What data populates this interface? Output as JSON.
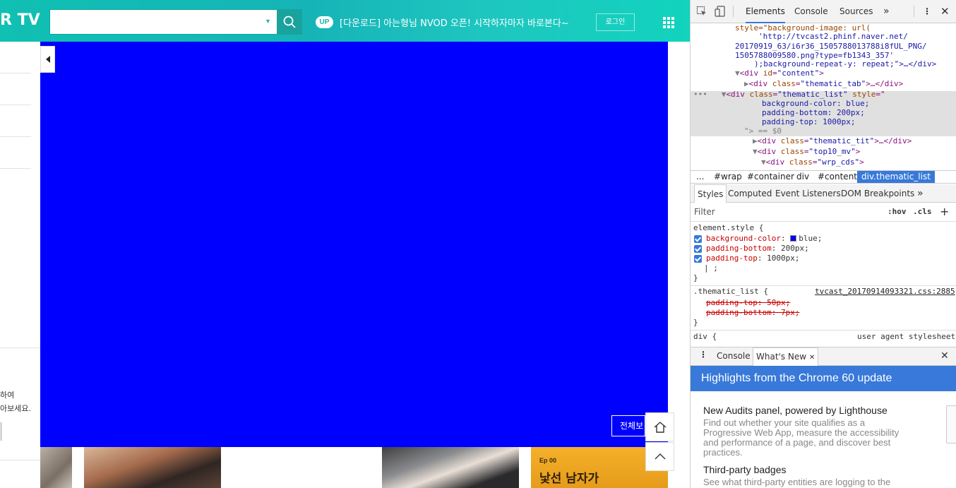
{
  "page": {
    "logo": "R TV",
    "search": {
      "value": "",
      "placeholder": ""
    },
    "up_badge": "UP",
    "notice": "[다운로드] 아는형님 NVOD 오픈! 시작하자마자 바로본다~",
    "login": "로그인",
    "left_panel": {
      "line1": "하여",
      "line2": "아보세요."
    },
    "all_button": "전체보",
    "thumb4_ep": "Ep 00",
    "thumb4_title": "낯선 남자가",
    "colors": {
      "header": "#16b4b7",
      "content_bg": "blue",
      "accent": "#1aa29c"
    }
  },
  "devtools": {
    "tabs": [
      "Elements",
      "Console",
      "Sources"
    ],
    "dom": {
      "l1": "style=\"background-image: url(",
      "l2": "'http://tvcast2.phinf.naver.net/",
      "l3": "20170919_63/i6r36_1505788013788i8fUL_PNG/",
      "l4": "1505788009580.png?type=fb1343_357'",
      "l5": ");background-repeat-y: repeat;\">…</div>",
      "l6_tag": "div",
      "l6_attr": "id",
      "l6_val": "\"content\"",
      "l7_class": "\"thematic_tab\"",
      "l8_class": "\"thematic_list\"",
      "l9": "background-color: blue;",
      "l10": "padding-bottom: 200px;",
      "l11": "padding-top: 1000px;",
      "l12": "\"> == $0",
      "l13_class": "\"thematic_tit\"",
      "l14_class": "\"top10_mv\"",
      "l15_class": "\"wrp_cds\""
    },
    "breadcrumbs": [
      "...",
      "#wrap",
      "#container",
      "div",
      "#content",
      "div.thematic_list"
    ],
    "styles_tabs": [
      "Styles",
      "Computed",
      "Event Listeners",
      "DOM Breakpoints"
    ],
    "filter": {
      "placeholder": "Filter",
      "hov": ":hov",
      "cls": ".cls"
    },
    "styles": {
      "element_style": "element.style {",
      "p1": "background-color",
      "v1": "blue",
      "p2": "padding-bottom",
      "v2": "200px",
      "p3": "padding-top",
      "v3": "1000px",
      "rule2_selector": ".thematic_list {",
      "rule2_source": "tvcast_20170914093321.css:2885",
      "s1": "padding-top: 50px;",
      "s2": "padding-bottom: 7px;",
      "rule3_selector": "div {",
      "rule3_source": "user agent stylesheet"
    },
    "drawer": {
      "console": "Console",
      "whats_new": "What's New"
    },
    "whats_new": {
      "banner": "Highlights from the Chrome 60 update",
      "h1": "New Audits panel, powered by Lighthouse",
      "p1": "Find out whether your site qualifies as a Progressive Web App, measure the accessibility and performance of a page, and discover best practices.",
      "h2": "Third-party badges",
      "p2": "See what third-party entities are logging to the"
    },
    "accent": "#3879d9"
  }
}
